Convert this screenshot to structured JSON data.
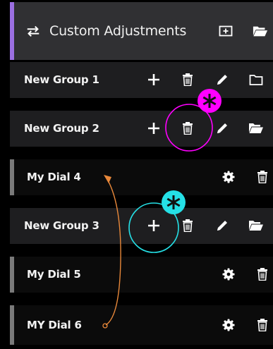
{
  "header": {
    "title": "Custom Adjustments",
    "icon": "swap-arrows-icon",
    "accent": "#9b6fe1"
  },
  "rows": [
    {
      "type": "group",
      "label": "New Group 1"
    },
    {
      "type": "group",
      "label": "New Group 2"
    },
    {
      "type": "dial",
      "label": "My Dial 4"
    },
    {
      "type": "group",
      "label": "New Group 3"
    },
    {
      "type": "dial",
      "label": "My Dial 5"
    },
    {
      "type": "dial",
      "label": "MY Dial 6"
    }
  ],
  "annotations": {
    "magenta": "#ff00ff",
    "cyan": "#25e0e6",
    "arrow": "#e8883a"
  }
}
